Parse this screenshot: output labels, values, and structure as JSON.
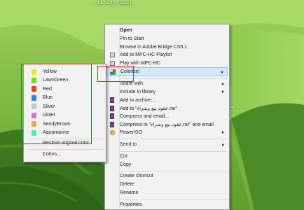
{
  "desktop": {
    "title_text": "...اضغط زرابط هنا",
    "file_label": "عقود بيع وشراء",
    "colors": {
      "accent_annotation": "#ee1c25",
      "highlight": "#d6e8fb"
    }
  },
  "context_menu": {
    "items": [
      {
        "label": "Open",
        "bold": true
      },
      {
        "label": "Pin to Start"
      },
      {
        "label": "Browse in Adobe Bridge CS5.1"
      },
      {
        "label": "Add to MPC-HC Playlist",
        "icon": "mpc-hc-icon"
      },
      {
        "label": "Play with MPC-HC",
        "icon": "mpc-hc-icon"
      },
      {
        "label": "Colorize!",
        "icon": "colorize-icon",
        "submenu": true,
        "highlighted": true
      },
      {
        "label": "Share with",
        "submenu": true
      },
      {
        "label": "Include in library",
        "submenu": true
      },
      {
        "label": "Add to archive...",
        "icon": "winrar-icon"
      },
      {
        "label": "Add to \"عقود بيع وشراء.rar\"",
        "icon": "winrar-icon"
      },
      {
        "label": "Compress and email...",
        "icon": "winrar-icon"
      },
      {
        "label": "Compress to \"عقود بيع وشراء.rar\" and email",
        "icon": "winrar-icon"
      },
      {
        "label": "PowerISO",
        "icon": "poweriso-icon",
        "submenu": true
      },
      {
        "label": "Send to",
        "submenu": true
      },
      {
        "label": "Cut"
      },
      {
        "label": "Copy"
      },
      {
        "label": "Create shortcut"
      },
      {
        "label": "Delete"
      },
      {
        "label": "Rename"
      },
      {
        "label": "Properties"
      }
    ]
  },
  "colorize_menu": {
    "colors": [
      {
        "label": "Yellow",
        "swatch": "#f2e33a"
      },
      {
        "label": "LawnGreen",
        "swatch": "#7cd32a"
      },
      {
        "label": "Red",
        "swatch": "#e0402f"
      },
      {
        "label": "Blue",
        "swatch": "#3d7fd9"
      },
      {
        "label": "Silver",
        "swatch": "#c9c9c9"
      },
      {
        "label": "Violet",
        "swatch": "#c779d6"
      },
      {
        "label": "SendyBrown",
        "swatch": "#e9a55a"
      },
      {
        "label": "Aquamarine",
        "swatch": "#5fe3b8"
      }
    ],
    "restore_label": "Restore original color",
    "colors_label": "Colors..."
  }
}
